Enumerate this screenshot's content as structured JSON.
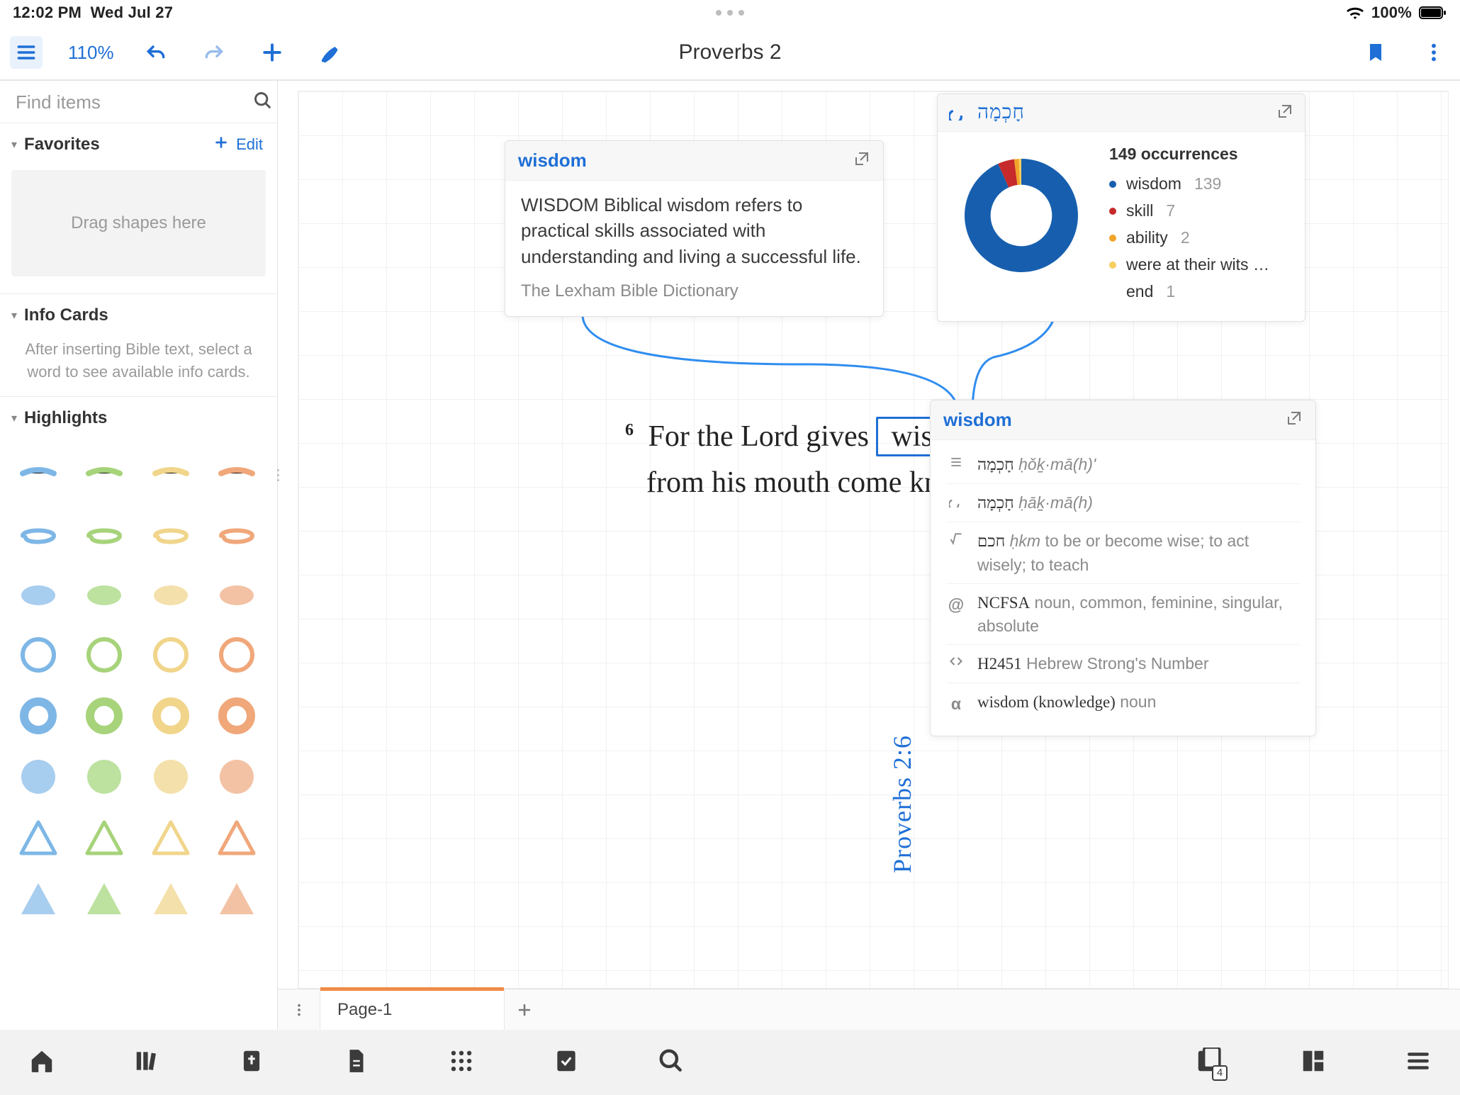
{
  "status": {
    "time": "12:02 PM",
    "date": "Wed Jul 27",
    "battery_percent": "100%"
  },
  "toolbar": {
    "zoom": "110%",
    "title": "Proverbs 2"
  },
  "sidebar": {
    "find_placeholder": "Find items",
    "favorites": {
      "title": "Favorites",
      "edit_label": "Edit",
      "drop_hint": "Drag shapes here"
    },
    "infocards": {
      "title": "Info Cards",
      "hint": "After inserting Bible text, select a word to see available info cards."
    },
    "highlights": {
      "title": "Highlights"
    }
  },
  "canvas": {
    "def_card": {
      "title": "wisdom",
      "body": "WISDOM Biblical wisdom refers to practical skills associated with understanding and living a successful life.",
      "source": "The Lexham Bible Dictionary"
    },
    "occ_card": {
      "heb": "חָכְמָה",
      "total_label": "149 occurrences",
      "legend": [
        {
          "label": "wisdom",
          "count": 139,
          "color": "#175fae"
        },
        {
          "label": "skill",
          "count": 7,
          "color": "#c62a2a"
        },
        {
          "label": "ability",
          "count": 2,
          "color": "#f0a52a"
        },
        {
          "label": "were at their wits …",
          "count": "",
          "color": "#f7cf5f"
        },
        {
          "label": "end",
          "count": 1,
          "color": ""
        }
      ]
    },
    "verse": {
      "num": "6",
      "pre": "For the Lord gives",
      "boxed": "wisdom",
      "line2": "from his mouth come knowledge and understanding;"
    },
    "reference": "Proverbs 2:6",
    "lex_card": {
      "title": "wisdom",
      "rows": [
        {
          "icon": "lines",
          "heb": "חָכְמָה",
          "translit": "ḥǒḵ·mā(h)ʹ",
          "detail": ""
        },
        {
          "icon": "arc",
          "heb": "חָכְמָה",
          "translit": "ḥāḵ·mā(h)",
          "detail": ""
        },
        {
          "icon": "root",
          "heb": "חכם",
          "translit": "ḥkm",
          "detail": "to be or become wise; to act wisely; to teach"
        },
        {
          "icon": "at",
          "heb": "NCFSA",
          "translit": "",
          "detail": "noun, common, feminine, singular, absolute"
        },
        {
          "icon": "code",
          "heb": "H2451",
          "translit": "",
          "detail": "Hebrew Strong's Number"
        },
        {
          "icon": "alpha",
          "heb": "wisdom (knowledge)",
          "translit": "",
          "detail": "noun"
        }
      ]
    }
  },
  "tabs": {
    "active": "Page-1"
  },
  "bottom_nav": {
    "notebook_badge": "4"
  },
  "chart_data": {
    "type": "pie",
    "title": "149 occurrences",
    "categories": [
      "wisdom",
      "skill",
      "ability",
      "were at their wits … end"
    ],
    "values": [
      139,
      7,
      2,
      1
    ],
    "colors": [
      "#175fae",
      "#c62a2a",
      "#f0a52a",
      "#f7cf5f"
    ]
  }
}
